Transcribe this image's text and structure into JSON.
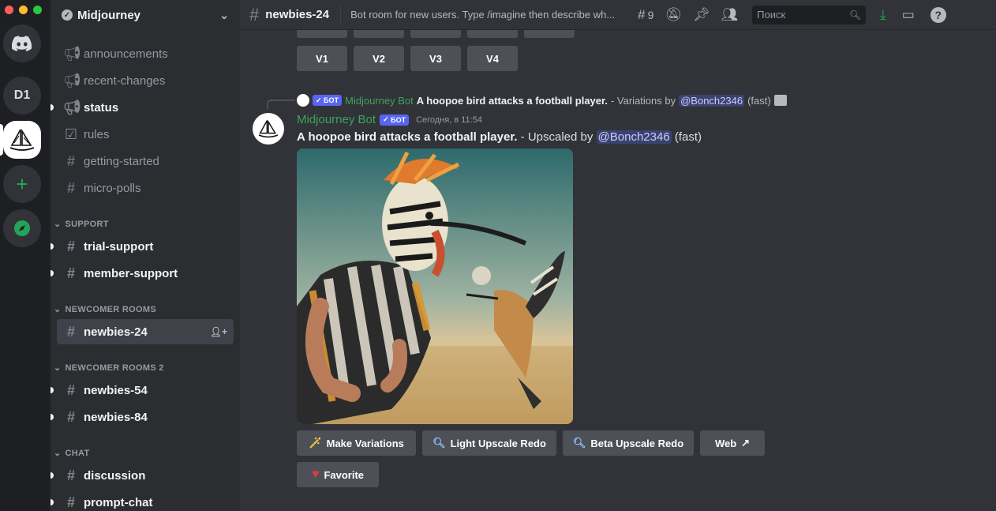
{
  "server_rail": {
    "servers": [
      "D1"
    ]
  },
  "guild": {
    "name": "Midjourney"
  },
  "channels": {
    "items": [
      {
        "name": "announcements",
        "icon": "megaphone-icon"
      },
      {
        "name": "recent-changes",
        "icon": "megaphone-icon"
      },
      {
        "name": "status",
        "icon": "megaphone-icon"
      },
      {
        "name": "rules",
        "icon": "checkbox-icon"
      },
      {
        "name": "getting-started",
        "icon": "hash-icon"
      },
      {
        "name": "micro-polls",
        "icon": "hash-icon"
      }
    ],
    "support": {
      "title": "SUPPORT",
      "items": [
        {
          "name": "trial-support"
        },
        {
          "name": "member-support"
        }
      ]
    },
    "newcomer": {
      "title": "NEWCOMER ROOMS",
      "items": [
        {
          "name": "newbies-24"
        }
      ]
    },
    "newcomer2": {
      "title": "NEWCOMER ROOMS 2",
      "items": [
        {
          "name": "newbies-54"
        },
        {
          "name": "newbies-84"
        }
      ]
    },
    "chat": {
      "title": "CHAT",
      "items": [
        {
          "name": "discussion"
        },
        {
          "name": "prompt-chat"
        }
      ]
    }
  },
  "topbar": {
    "channel": "newbies-24",
    "topic": "Bot room for new users. Type /imagine then describe wh...",
    "threads_count": "9",
    "search_placeholder": "Поиск"
  },
  "message": {
    "variation_buttons": [
      "V1",
      "V2",
      "V3",
      "V4"
    ],
    "reply": {
      "bot_badge": "БОТ",
      "author": "Midjourney Bot",
      "prompt": "A hoopoe bird attacks a football player.",
      "suffix": " - Variations by ",
      "mention": "@Bonch2346",
      "speed": " (fast)"
    },
    "author": "Midjourney Bot",
    "bot_badge": "БОТ",
    "timestamp": "Сегодня, в 11:54",
    "prompt": "A hoopoe bird attacks a football player.",
    "suffix": " - Upscaled by ",
    "mention": "@Bonch2346",
    "speed": " (fast)",
    "actions": [
      {
        "label": "Make Variations",
        "icon": "magic-wand-icon"
      },
      {
        "label": "Light Upscale Redo",
        "icon": "magnifier-icon"
      },
      {
        "label": "Beta Upscale Redo",
        "icon": "magnifier-icon"
      },
      {
        "label": "Web",
        "icon": "external-link-icon"
      },
      {
        "label": "Favorite",
        "icon": "heart-icon"
      }
    ]
  },
  "colors": {
    "accent": "#5865f2",
    "bot_name": "#3ba55c",
    "add_server": "#23a559"
  }
}
